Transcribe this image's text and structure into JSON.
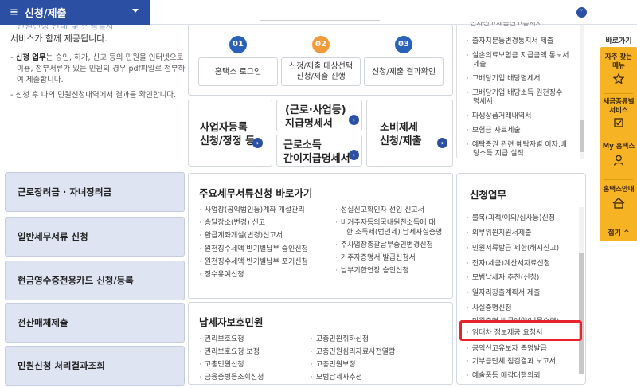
{
  "menu": {
    "hamburger": "≡",
    "title": "신청/제출",
    "caret_icon": "triangle-down"
  },
  "intro": {
    "cut_line": "민원신청 안내 및 진행절차",
    "lead": "서비스가 함께 제공됩니다.",
    "note1_bold": "신청 업무",
    "note1": "는 승인, 허가, 신고 등의 민원을 인터넷으로 이용, 첨부서류가 있는 민원의 경우 pdf파일로 첨부하여 제출합니다.",
    "note2": "신청 후 나의 민원신청내역에서 결과를 확인합니다."
  },
  "steps": [
    {
      "num": "01",
      "label": "홈택스 로그인",
      "color": "#2a62b8"
    },
    {
      "num": "02",
      "label": "신청/제출 대상선택\n신청/제출 진행",
      "color": "#f39a3a"
    },
    {
      "num": "03",
      "label": "신청/제출 결과확인",
      "color": "#2a62b8"
    }
  ],
  "big_buttons": {
    "biz": "사업자등록\n신청/정정 등",
    "income": "(근로·사업등)\n지급명세서",
    "simple": "근로소득\n간이지급명세서",
    "excise": "소비제세\n신청/제출",
    "arrow": "›"
  },
  "left_menu": [
    {
      "label": "근로장려금 · 자녀장려금"
    },
    {
      "label": "일반세무서류 신청"
    },
    {
      "label": "현금영수증전용카드 신청/등록"
    },
    {
      "label": "전산매체제출"
    },
    {
      "label": "민원신청 처리결과조회"
    }
  ],
  "main_docs": {
    "title": "주요세무서류신청 바로가기",
    "col1": [
      "사업장(공익법인등)계좌 개설관리",
      "송달장소(변경) 신고",
      "환급계좌개설(변경)신고서",
      "원천징수세액 반기별납부 승인신청",
      "원천징수세액 반기별납부 포기신청",
      "징수유예신청"
    ],
    "col2": [
      "성실신고확인자 선임 신고서",
      "비거주자등의국내원천소득에 대",
      "한 소득세(법인세) 납세사실증명",
      "주사업장총괄납부승인변경신청",
      "거주자증명서 발급신청서",
      "납부기한연장 승인신청"
    ]
  },
  "protect": {
    "title": "납세자보호민원",
    "col1": [
      "권리보호요청",
      "권리보호요청 보정",
      "고충민원신청",
      "금융증빙등조회신청"
    ],
    "col2": [
      "고충민원취하신청",
      "고충민원심리자료사전열람",
      "고충민원보정",
      "모범납세자추천"
    ]
  },
  "right_top": {
    "items": [
      "출자지분등변경통지서 제출",
      "실손의료보험금 지급금액 통보서",
      "제출",
      "고배당기업 배당명세서",
      "고배당기업 배당소득 원천징수",
      "명세서",
      "파생상품거래내역서",
      "보험금 자료제출",
      "예탁증권 관련 예탁자별 이자,배",
      "당소득 지급 실적"
    ],
    "cut": "전자신고세금신고통지서"
  },
  "apply": {
    "title": "신청업무",
    "items": [
      "불복(과적/이의/심사등)신청",
      "외부위원지원서제출",
      "민원서류발급 제한(해지신고)",
      "전자(세금)계산서자료신청",
      "모범납세자 추천(신청)",
      "일자리창출계획서 제출",
      "사실증명신청",
      "민원증명 발급예약(방문수령)",
      "임대차 정보제공 요청서",
      "공익신고유보자 증명발급",
      "기부금단체 점검결과 보고서",
      "예술품등 매각대행의뢰"
    ]
  },
  "quick": {
    "label": "바로가기",
    "items": [
      "자주 찾는\n메뉴",
      "세금종류별\n서비스",
      "My 홈택스",
      "홈택스안내"
    ],
    "close": "접기 ^"
  },
  "colors": {
    "brand": "#2a4fa3",
    "quick": "#f6b324",
    "highlight": "#e8232b",
    "left_btn": "#dfe4f3"
  }
}
